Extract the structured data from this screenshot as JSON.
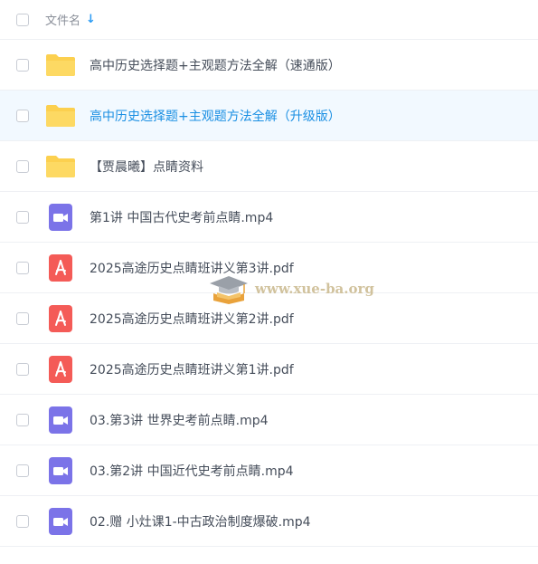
{
  "header": {
    "column_label": "文件名",
    "sort_icon": "arrow-down-icon"
  },
  "files": [
    {
      "name": "高中历史选择题+主观题方法全解（速通版）",
      "type": "folder",
      "icon": "folder-icon"
    },
    {
      "name": "高中历史选择题+主观题方法全解（升级版）",
      "type": "folder",
      "icon": "folder-icon",
      "highlighted": true
    },
    {
      "name": "【贾晨曦】点睛资料",
      "type": "folder",
      "icon": "folder-icon"
    },
    {
      "name": "第1讲 中国古代史考前点睛.mp4",
      "type": "video",
      "icon": "video-icon"
    },
    {
      "name": "2025高途历史点睛班讲义第3讲.pdf",
      "type": "pdf",
      "icon": "pdf-icon"
    },
    {
      "name": "2025高途历史点睛班讲义第2讲.pdf",
      "type": "pdf",
      "icon": "pdf-icon"
    },
    {
      "name": "2025高途历史点睛班讲义第1讲.pdf",
      "type": "pdf",
      "icon": "pdf-icon"
    },
    {
      "name": "03.第3讲 世界史考前点睛.mp4",
      "type": "video",
      "icon": "video-icon"
    },
    {
      "name": "03.第2讲 中国近代史考前点睛.mp4",
      "type": "video",
      "icon": "video-icon"
    },
    {
      "name": "02.赠 小灶课1-中古政治制度爆破.mp4",
      "type": "video",
      "icon": "video-icon"
    }
  ],
  "watermark": {
    "text": "www.xue-ba.org",
    "icon": "graduation-cap-icon"
  },
  "colors": {
    "folder": "#fcd04f",
    "pdf": "#f45b57",
    "video": "#7b73e8",
    "highlight_text": "#1a8fe3",
    "highlight_bg": "#f2f9ff"
  }
}
